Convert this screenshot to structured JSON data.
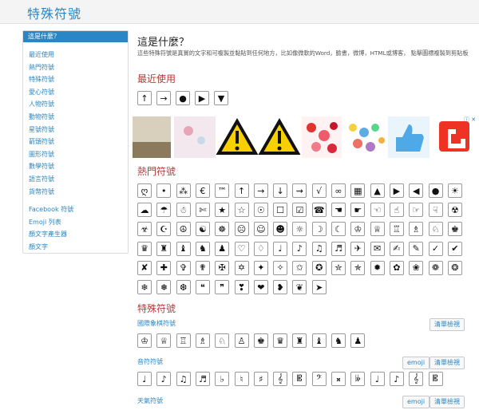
{
  "site": {
    "title": "特殊符號"
  },
  "sidebar": {
    "active": "這是什麼？",
    "items": [
      "最近使用",
      "熱門符號",
      "特殊符號",
      "愛心符號",
      "人物符號",
      "動物符號",
      "星號符號",
      "箭頭符號",
      "圖形符號",
      "數學符號",
      "語言符號",
      "貨幣符號"
    ],
    "links": [
      "Facebook 符號",
      "Emoji 列表",
      "顏文字產生器",
      "顏文字"
    ]
  },
  "intro": {
    "heading": "這是什麼？",
    "text": "這些特殊符號是真實的文字和可複製並黏貼到任何地方，比如像微軟的Word，臉書，微博，HTML或博客， 點擊圖標複製到剪貼板"
  },
  "recent": {
    "heading": "最近使用",
    "symbols": [
      "↑",
      "→",
      "●",
      "▶",
      "▼"
    ]
  },
  "popular": {
    "heading": "熱門符號",
    "symbols": [
      "ღ",
      "•",
      "⁂",
      "€",
      "™",
      "↑",
      "→",
      "↓",
      "⇝",
      "√",
      "∞",
      "▦",
      "▲",
      "▶",
      "◀",
      "●",
      "☀",
      "☁",
      "☂",
      "☃",
      "✄",
      "★",
      "☆",
      "☉",
      "☐",
      "☑",
      "☎",
      "☚",
      "☛",
      "☜",
      "☝",
      "☞",
      "☟",
      "☢",
      "☣",
      "☪",
      "☮",
      "☯",
      "☸",
      "☹",
      "☺",
      "☻",
      "☼",
      "☽",
      "☾",
      "♔",
      "♕",
      "♖",
      "♗",
      "♘",
      "♚",
      "♛",
      "♜",
      "♝",
      "♞",
      "♟",
      "♡",
      "♢",
      "♩",
      "♪",
      "♫",
      "♬",
      "✈",
      "✉",
      "✍",
      "✎",
      "✓",
      "✔",
      "✘",
      "✚",
      "✞",
      "✟",
      "✠",
      "✡",
      "✦",
      "✧",
      "✩",
      "✪",
      "✮",
      "✯",
      "✹",
      "✿",
      "❀",
      "❁",
      "❂",
      "❄",
      "❅",
      "❆",
      "❝",
      "❞",
      "❣",
      "❤",
      "❥",
      "❦",
      "➤"
    ]
  },
  "special": {
    "heading": "特殊符號"
  },
  "chess": {
    "title": "國際象棋符號",
    "button": "清單檢視",
    "symbols": [
      "♔",
      "♕",
      "♖",
      "♗",
      "♘",
      "♙",
      "♚",
      "♛",
      "♜",
      "♝",
      "♞",
      "♟"
    ]
  },
  "music": {
    "title": "音符符號",
    "emoji_button": "emoji",
    "button": "清單檢視",
    "symbols": [
      "♩",
      "♪",
      "♫",
      "♬",
      "♭",
      "♮",
      "♯",
      "𝄞",
      "𝄡",
      "𝄢",
      "𝄪",
      "𝄫",
      "♩",
      "♪",
      "𝄞",
      "𝄡"
    ]
  },
  "weather": {
    "title": "天氣符號",
    "emoji_button": "emoji",
    "button": "清單檢視"
  },
  "ad": {
    "label": "ⓘ ✕"
  }
}
